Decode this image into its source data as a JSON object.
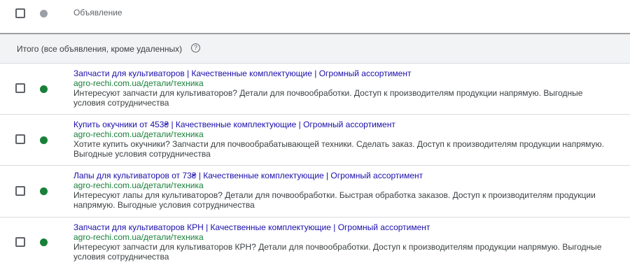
{
  "colors": {
    "active_status": "#188038",
    "header_status": "#9aa0a6",
    "title_link": "#1a0dab",
    "url": "#188038"
  },
  "header": {
    "column_label": "Объявление"
  },
  "total_row": {
    "label": "Итого (все объявления, кроме удаленных)",
    "help_icon": "?"
  },
  "ads": [
    {
      "status": "active",
      "title": "Запчасти для культиваторов | Качественные комплектующие | Огромный ассортимент",
      "url": "agro-rechi.com.ua/детали/техника",
      "description": "Интересуют запчасти для культиваторов? Детали для почвообработки. Доступ к производителям продукции напрямую. Выгодные условия сотрудничества"
    },
    {
      "status": "active",
      "title": "Купить окучники от 453₴ | Качественные комплектующие | Огромный ассортимент",
      "url": "agro-rechi.com.ua/детали/техника",
      "description": "Хотите купить окучники? Запчасти для почвообрабатывающей техники. Сделать заказ. Доступ к производителям продукции напрямую. Выгодные условия сотрудничества"
    },
    {
      "status": "active",
      "title": "Лапы для культиваторов от 73₴ | Качественные комплектующие | Огромный ассортимент",
      "url": "agro-rechi.com.ua/детали/техника",
      "description": "Интересуют лапы для культиваторов? Детали для почвообработки. Быстрая обработка заказов. Доступ к производителям продукции напрямую. Выгодные условия сотрудничества"
    },
    {
      "status": "active",
      "title": "Запчасти для культиваторов КРН | Качественные комплектующие | Огромный ассортимент",
      "url": "agro-rechi.com.ua/детали/техника",
      "description": "Интересуют запчасти для культиваторов КРН? Детали для почвообработки. Доступ к производителям продукции напрямую. Выгодные условия сотрудничества"
    }
  ]
}
